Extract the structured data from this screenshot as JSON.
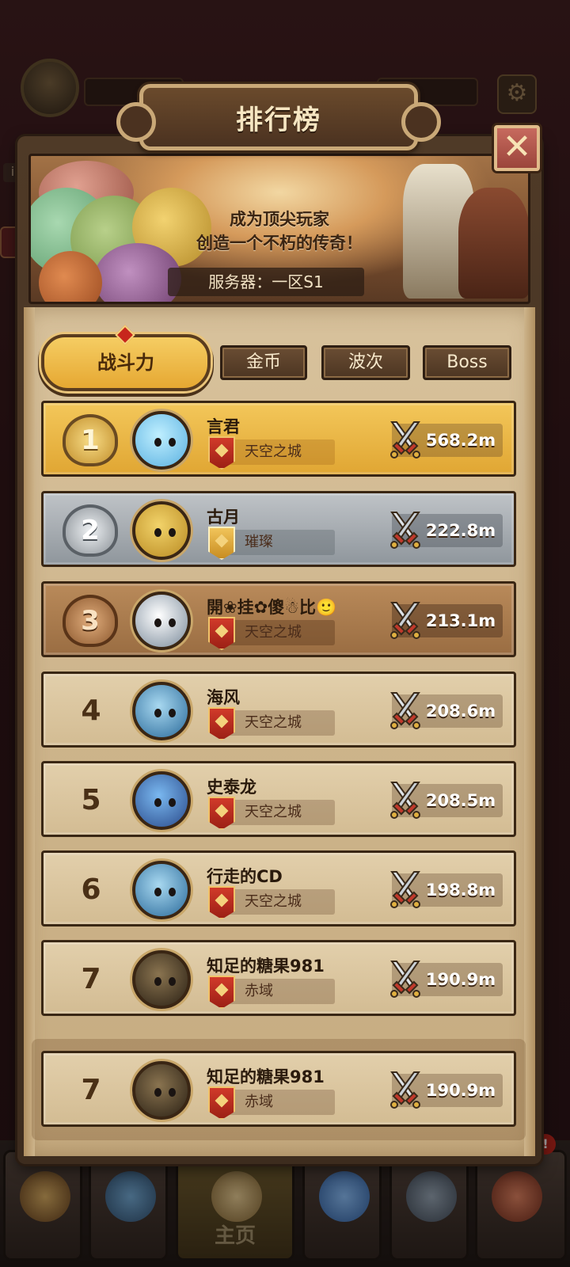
{
  "panel": {
    "title": "排行榜",
    "close_label": "X",
    "banner": {
      "line1": "成为顶尖玩家",
      "line2": "创造一个不朽的传奇！",
      "server": "服务器：一区S1"
    }
  },
  "tabs": [
    {
      "label": "战斗力",
      "active": true
    },
    {
      "label": "金币",
      "active": false
    },
    {
      "label": "波次",
      "active": false
    },
    {
      "label": "Boss",
      "active": false
    }
  ],
  "rankings": [
    {
      "rank": "1",
      "name": "言君",
      "guild": "天空之城",
      "power": "568.2m",
      "tier": "gold"
    },
    {
      "rank": "2",
      "name": "古月",
      "guild": "璀璨",
      "power": "222.8m",
      "tier": "silver"
    },
    {
      "rank": "3",
      "name": "開❀挂✿傻☃比🙂",
      "guild": "天空之城",
      "power": "213.1m",
      "tier": "bronze"
    },
    {
      "rank": "4",
      "name": "海风",
      "guild": "天空之城",
      "power": "208.6m",
      "tier": "plain"
    },
    {
      "rank": "5",
      "name": "史泰龙",
      "guild": "天空之城",
      "power": "208.5m",
      "tier": "plain"
    },
    {
      "rank": "6",
      "name": "行走的CD",
      "guild": "天空之城",
      "power": "198.8m",
      "tier": "plain"
    },
    {
      "rank": "7",
      "name": "知足的糖果981",
      "guild": "赤域",
      "power": "190.9m",
      "tier": "plain"
    }
  ],
  "my_rank": {
    "rank": "7",
    "name": "知足的糖果981",
    "guild": "赤域",
    "power": "190.9m"
  },
  "background": {
    "nav_home_label": "主页",
    "notification_badge": "!"
  },
  "icons": {
    "close": "close-icon",
    "power": "crossed-swords-icon",
    "guild": "guild-banner-icon",
    "settings": "gear-icon"
  },
  "colors": {
    "gold_row": "#f3c75a",
    "silver_row": "#bfc3c7",
    "bronze_row": "#b98a5a",
    "plain_row": "#e2cfab",
    "guild_red": "#d13a2a"
  }
}
